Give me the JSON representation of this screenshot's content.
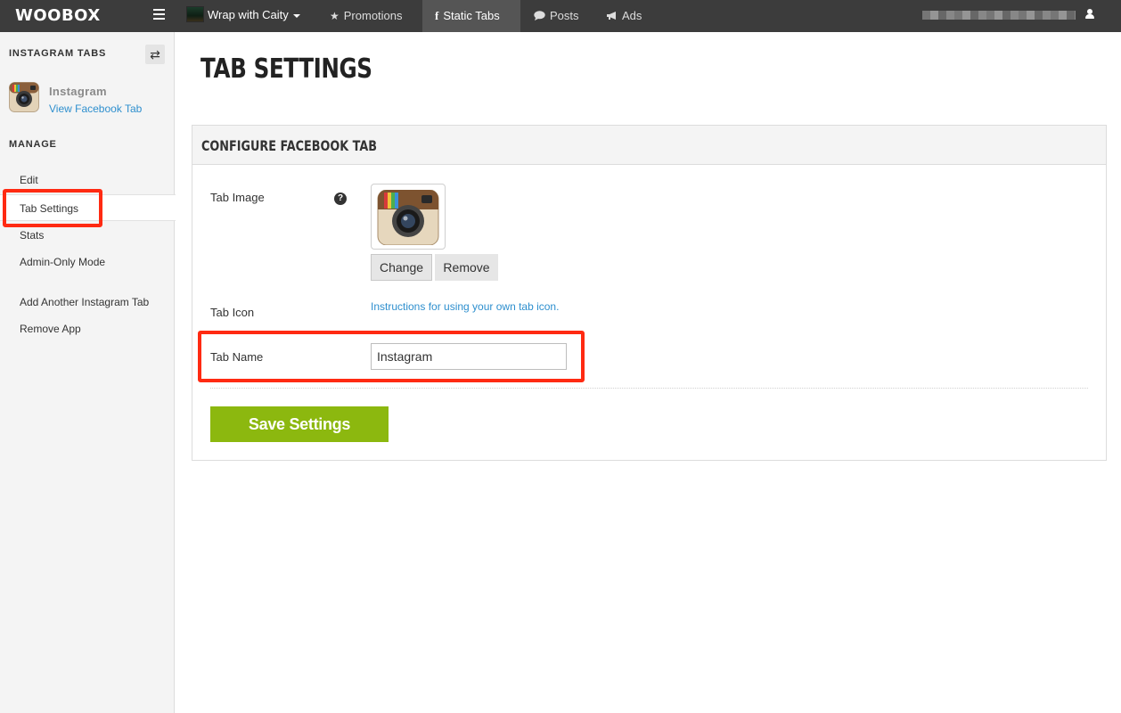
{
  "topbar": {
    "logo": "WOOBOX",
    "page_name": "Wrap with Caity",
    "nav": [
      {
        "label": "Promotions",
        "icon": "star-icon"
      },
      {
        "label": "Static Tabs",
        "icon": "facebook-icon"
      },
      {
        "label": "Posts",
        "icon": "speech-bubble-icon"
      },
      {
        "label": "Ads",
        "icon": "megaphone-icon"
      }
    ]
  },
  "sidebar": {
    "heading": "INSTAGRAM TABS",
    "app_name": "Instagram",
    "app_link": "View Facebook Tab",
    "manage_heading": "MANAGE",
    "items": [
      {
        "label": "Edit"
      },
      {
        "label": "Tab Settings"
      },
      {
        "label": "Stats"
      },
      {
        "label": "Admin-Only Mode"
      },
      {
        "label": "Add Another Instagram Tab"
      },
      {
        "label": "Remove App"
      }
    ]
  },
  "main": {
    "title": "TAB SETTINGS",
    "panel_title": "CONFIGURE FACEBOOK TAB",
    "tab_image_label": "Tab Image",
    "change_label": "Change",
    "remove_label": "Remove",
    "tab_icon_label": "Tab Icon",
    "instructions_link": "Instructions for using your own tab icon.",
    "tab_name_label": "Tab Name",
    "tab_name_value": "Instagram",
    "save_label": "Save Settings"
  },
  "colors": {
    "topbar_bg": "#3c3c3c",
    "active_nav_bg": "#555555",
    "link": "#2e8fce",
    "save_button": "#8cb80f",
    "annotation": "#ff2a12"
  }
}
